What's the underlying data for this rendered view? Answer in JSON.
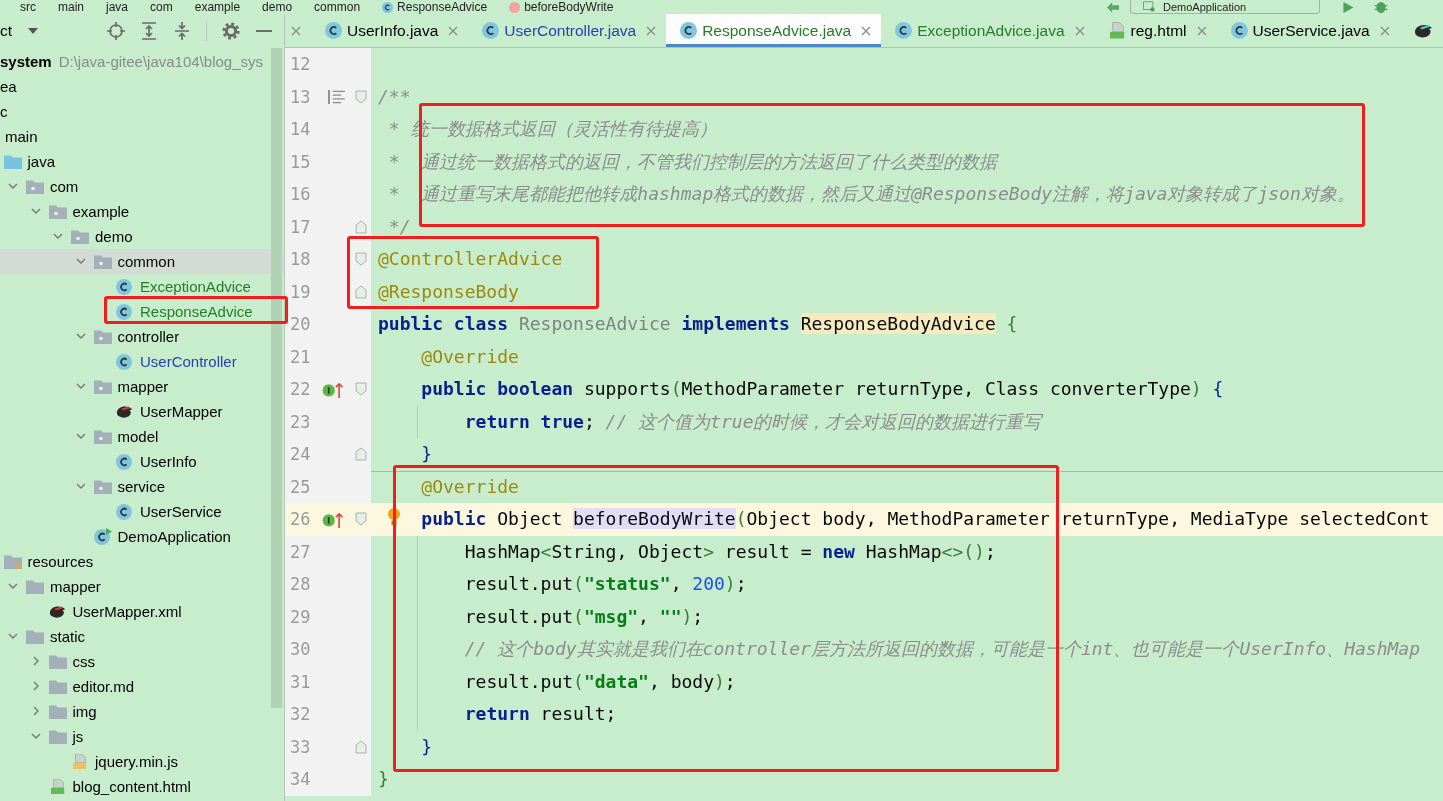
{
  "breadcrumbs": [
    {
      "label": "src"
    },
    {
      "label": "main"
    },
    {
      "label": "java"
    },
    {
      "label": "com"
    },
    {
      "label": "example"
    },
    {
      "label": "demo"
    },
    {
      "label": "common"
    },
    {
      "label": "ResponseAdvice",
      "kind": "class"
    },
    {
      "label": "beforeBodyWrite",
      "kind": "method"
    }
  ],
  "run_config": {
    "label": "DemoApplication"
  },
  "project_panel": {
    "title": "ct",
    "tree": [
      {
        "label": "system",
        "kind": "module",
        "path": "D:\\java-gitee\\java104\\blog_sys",
        "selected": false,
        "children": [
          {
            "label": "ea",
            "selected": false
          },
          {
            "label": "c",
            "selected": false,
            "children": [
              {
                "label": "main",
                "selected": false,
                "children": [
                  {
                    "label": "java",
                    "kind": "source-root",
                    "selected": false,
                    "children": [
                      {
                        "label": "com",
                        "kind": "package",
                        "expanded": true,
                        "selected": false,
                        "children": [
                          {
                            "label": "example",
                            "kind": "package",
                            "expanded": true,
                            "selected": false,
                            "children": [
                              {
                                "label": "demo",
                                "kind": "package",
                                "expanded": true,
                                "selected": false,
                                "children": [
                                  {
                                    "label": "common",
                                    "kind": "package",
                                    "expanded": true,
                                    "selected": true,
                                    "children": [
                                      {
                                        "label": "ExceptionAdvice",
                                        "kind": "class",
                                        "color": "#287c28",
                                        "selected": false
                                      },
                                      {
                                        "label": "ResponseAdvice",
                                        "kind": "class",
                                        "color": "#287c28",
                                        "selected": false
                                      }
                                    ]
                                  },
                                  {
                                    "label": "controller",
                                    "kind": "package",
                                    "expanded": true,
                                    "selected": false,
                                    "children": [
                                      {
                                        "label": "UserController",
                                        "kind": "class",
                                        "color": "#2642b2",
                                        "selected": false
                                      }
                                    ]
                                  },
                                  {
                                    "label": "mapper",
                                    "kind": "package",
                                    "expanded": true,
                                    "selected": false,
                                    "children": [
                                      {
                                        "label": "UserMapper",
                                        "kind": "mapper",
                                        "selected": false
                                      }
                                    ]
                                  },
                                  {
                                    "label": "model",
                                    "kind": "package",
                                    "expanded": true,
                                    "selected": false,
                                    "children": [
                                      {
                                        "label": "UserInfo",
                                        "kind": "class",
                                        "selected": false
                                      }
                                    ]
                                  },
                                  {
                                    "label": "service",
                                    "kind": "package",
                                    "expanded": true,
                                    "selected": false,
                                    "children": [
                                      {
                                        "label": "UserService",
                                        "kind": "class",
                                        "selected": false
                                      }
                                    ]
                                  },
                                  {
                                    "label": "DemoApplication",
                                    "kind": "app-class",
                                    "selected": false
                                  }
                                ]
                              }
                            ]
                          }
                        ]
                      }
                    ]
                  },
                  {
                    "label": "resources",
                    "kind": "resource-root",
                    "selected": false,
                    "children": [
                      {
                        "label": "mapper",
                        "kind": "folder",
                        "expanded": true,
                        "selected": false,
                        "children": [
                          {
                            "label": "UserMapper.xml",
                            "kind": "mapper",
                            "selected": false
                          }
                        ]
                      },
                      {
                        "label": "static",
                        "kind": "folder",
                        "expanded": true,
                        "selected": false,
                        "children": [
                          {
                            "label": "css",
                            "kind": "folder",
                            "expanded": false,
                            "selected": false
                          },
                          {
                            "label": "editor.md",
                            "kind": "folder",
                            "expanded": false,
                            "selected": false
                          },
                          {
                            "label": "img",
                            "kind": "folder",
                            "expanded": false,
                            "selected": false
                          },
                          {
                            "label": "js",
                            "kind": "folder",
                            "expanded": true,
                            "selected": false,
                            "children": [
                              {
                                "label": "jquery.min.js",
                                "kind": "js",
                                "selected": false
                              }
                            ]
                          },
                          {
                            "label": "blog_content.html",
                            "kind": "html",
                            "selected": false
                          }
                        ]
                      }
                    ]
                  }
                ]
              }
            ]
          }
        ]
      }
    ]
  },
  "editor": {
    "tabs": [
      {
        "label": "UserInfo.java",
        "kind": "class",
        "selected": false
      },
      {
        "label": "UserController.java",
        "kind": "class",
        "color": "#2642b2",
        "selected": false
      },
      {
        "label": "ResponseAdvice.java",
        "kind": "class",
        "color": "#287c28",
        "selected": true
      },
      {
        "label": "ExceptionAdvice.java",
        "kind": "class",
        "color": "#287c28",
        "selected": false
      },
      {
        "label": "reg.html",
        "kind": "html",
        "selected": false
      },
      {
        "label": "UserService.java",
        "kind": "class",
        "selected": false
      },
      {
        "kind": "mapper",
        "selected": false
      }
    ],
    "lines": [
      {
        "number": "12",
        "current": false
      },
      {
        "number": "13",
        "current": false,
        "fold_start": true,
        "doc_marker": true,
        "tokens": [
          {
            "kind": "comment",
            "text": "/**"
          }
        ]
      },
      {
        "number": "14",
        "current": false,
        "tokens": [
          {
            "kind": "comment",
            "text": " * 统一数据格式返回（灵活性有待提高）"
          }
        ]
      },
      {
        "number": "15",
        "current": false,
        "tokens": [
          {
            "kind": "comment",
            "text": " *  通过统一数据格式的返回，不管我们控制层的方法返回了什么类型的数据"
          }
        ]
      },
      {
        "number": "16",
        "current": false,
        "tokens": [
          {
            "kind": "comment",
            "text": " *  通过重写末尾都能把他转成hashmap格式的数据，然后又通过@ResponseBody注解，将java对象转成了json对象。"
          }
        ]
      },
      {
        "number": "17",
        "current": false,
        "fold_end": true,
        "tokens": [
          {
            "kind": "comment",
            "text": " */"
          }
        ]
      },
      {
        "number": "18",
        "current": false,
        "fold_start": true,
        "tokens": [
          {
            "kind": "annotation",
            "text": "@ControllerAdvice"
          }
        ]
      },
      {
        "number": "19",
        "current": false,
        "fold_end": true,
        "tokens": [
          {
            "kind": "annotation",
            "text": "@ResponseBody"
          }
        ]
      },
      {
        "number": "20",
        "current": false,
        "tokens": [
          {
            "kind": "keyword",
            "text": "public"
          },
          {
            "kind": "keyword",
            "text": " class"
          },
          {
            "kind": "dim",
            "text": " ResponseAdvice"
          },
          {
            "kind": "keyword",
            "text": " implements "
          },
          {
            "kind": "warn",
            "text": "ResponseBodyAdvice"
          },
          {
            "kind": "bracket",
            "text": " {"
          }
        ]
      },
      {
        "number": "21",
        "current": false,
        "tokens": [
          {
            "kind": "annotation",
            "text": "    @Override"
          }
        ]
      },
      {
        "number": "22",
        "current": false,
        "fold_start": true,
        "override_marker": true,
        "tokens": [
          {
            "kind": "keyword",
            "text": "    public"
          },
          {
            "kind": "keyword",
            "text": " boolean"
          },
          {
            "kind": "plain",
            "text": " supports"
          },
          {
            "kind": "bracket",
            "text": "("
          },
          {
            "kind": "plain",
            "text": "MethodParameter returnType, Class converterType"
          },
          {
            "kind": "bracket",
            "text": ")"
          },
          {
            "kind": "brace",
            "text": " {"
          }
        ]
      },
      {
        "number": "23",
        "current": false,
        "tokens": [
          {
            "kind": "keyword",
            "text": "        return"
          },
          {
            "kind": "keyword",
            "text": " true"
          },
          {
            "kind": "plain",
            "text": "; "
          },
          {
            "kind": "comment",
            "text": "// 这个值为true的时候，才会对返回的数据进行重写"
          }
        ]
      },
      {
        "number": "24",
        "current": false,
        "fold_end": true,
        "tokens": [
          {
            "kind": "brace",
            "text": "    }"
          }
        ]
      },
      {
        "number": "25",
        "current": false,
        "separator_above": true,
        "tokens": [
          {
            "kind": "annotation",
            "text": "    @Override"
          }
        ]
      },
      {
        "number": "26",
        "current": true,
        "fold_start": true,
        "override_marker": true,
        "intention": true,
        "tokens": [
          {
            "kind": "keyword",
            "text": "    public"
          },
          {
            "kind": "plain",
            "text": " Object "
          },
          {
            "kind": "usage",
            "text": "beforeBodyWrite"
          },
          {
            "kind": "bracket",
            "text": "("
          },
          {
            "kind": "plain",
            "text": "Object body, MethodParameter returnType, MediaType selectedCont"
          }
        ]
      },
      {
        "number": "27",
        "current": false,
        "tokens": [
          {
            "kind": "plain",
            "text": "        HashMap"
          },
          {
            "kind": "bracket",
            "text": "<"
          },
          {
            "kind": "plain",
            "text": "String, Object"
          },
          {
            "kind": "bracket",
            "text": ">"
          },
          {
            "kind": "plain",
            "text": " result = "
          },
          {
            "kind": "keyword",
            "text": "new"
          },
          {
            "kind": "plain",
            "text": " HashMap"
          },
          {
            "kind": "bracket",
            "text": "<>()"
          },
          {
            "kind": "plain",
            "text": ";"
          }
        ]
      },
      {
        "number": "28",
        "current": false,
        "tokens": [
          {
            "kind": "plain",
            "text": "        result.put"
          },
          {
            "kind": "bracket",
            "text": "("
          },
          {
            "kind": "string",
            "text": "\"status\""
          },
          {
            "kind": "plain",
            "text": ", "
          },
          {
            "kind": "number",
            "text": "200"
          },
          {
            "kind": "bracket",
            "text": ")"
          },
          {
            "kind": "plain",
            "text": ";"
          }
        ]
      },
      {
        "number": "29",
        "current": false,
        "tokens": [
          {
            "kind": "plain",
            "text": "        result.put"
          },
          {
            "kind": "bracket",
            "text": "("
          },
          {
            "kind": "string",
            "text": "\"msg\""
          },
          {
            "kind": "plain",
            "text": ", "
          },
          {
            "kind": "string",
            "text": "\"\""
          },
          {
            "kind": "bracket",
            "text": ")"
          },
          {
            "kind": "plain",
            "text": ";"
          }
        ]
      },
      {
        "number": "30",
        "current": false,
        "tokens": [
          {
            "kind": "comment",
            "text": "        // 这个body其实就是我们在controller层方法所返回的数据，可能是一个int、也可能是一个UserInfo、HashMap"
          }
        ]
      },
      {
        "number": "31",
        "current": false,
        "tokens": [
          {
            "kind": "plain",
            "text": "        result.put"
          },
          {
            "kind": "bracket",
            "text": "("
          },
          {
            "kind": "string",
            "text": "\"data\""
          },
          {
            "kind": "plain",
            "text": ", body"
          },
          {
            "kind": "bracket",
            "text": ")"
          },
          {
            "kind": "plain",
            "text": ";"
          }
        ]
      },
      {
        "number": "32",
        "current": false,
        "tokens": [
          {
            "kind": "keyword",
            "text": "        return"
          },
          {
            "kind": "plain",
            "text": " result;"
          }
        ]
      },
      {
        "number": "33",
        "current": false,
        "fold_end": true,
        "tokens": [
          {
            "kind": "brace",
            "text": "    }"
          }
        ]
      },
      {
        "number": "34",
        "current": false,
        "tokens": [
          {
            "kind": "bracket",
            "text": "}"
          }
        ]
      }
    ]
  }
}
